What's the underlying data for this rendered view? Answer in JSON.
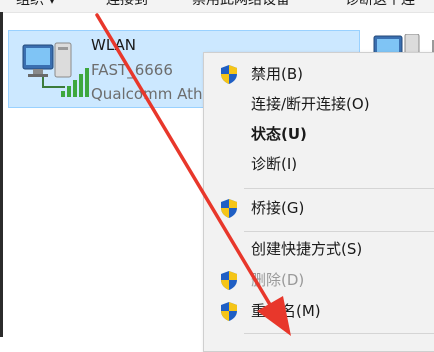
{
  "toolbar": {
    "organize": "组织 ▾",
    "connect_to": "连接到",
    "disable_device": "禁用此网络设备",
    "diagnose": "诊断这个连"
  },
  "adapter": {
    "name": "WLAN",
    "ssid": "FAST_6666",
    "device": "Qualcomm Atheros"
  },
  "context_menu": {
    "disable": "禁用(B)",
    "connect_disconnect": "连接/断开连接(O)",
    "status": "状态(U)",
    "diagnose": "诊断(I)",
    "bridge": "桥接(G)",
    "create_shortcut": "创建快捷方式(S)",
    "delete": "删除(D)",
    "rename": "重命名(M)"
  },
  "colors": {
    "selection_bg": "#cce8ff",
    "menu_bg": "#f2f2f2",
    "arrow": "#e8372b",
    "shield_blue": "#1f5fc4",
    "shield_yellow": "#f5c518"
  }
}
